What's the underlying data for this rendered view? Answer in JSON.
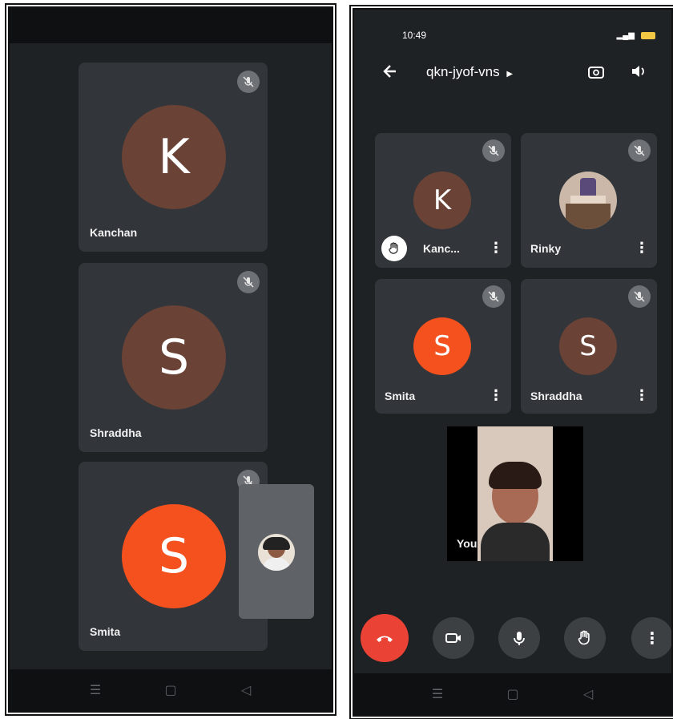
{
  "left_screen": {
    "participants": [
      {
        "initial": "K",
        "name": "Kanchan",
        "color": "#6a4236"
      },
      {
        "initial": "S",
        "name": "Shraddha",
        "color": "#6a4236"
      },
      {
        "initial": "S",
        "name": "Smita",
        "color": "#f4511e"
      }
    ]
  },
  "right_screen": {
    "status": {
      "time": "10:49"
    },
    "meeting_code": "qkn-jyof-vns",
    "participants": [
      {
        "initial": "K",
        "name": "Kanc...",
        "color": "#6a4236",
        "hand_raised": true
      },
      {
        "initial": "",
        "name": "Rinky",
        "color": "#8a7a7a"
      },
      {
        "initial": "S",
        "name": "Smita",
        "color": "#f4511e"
      },
      {
        "initial": "S",
        "name": "Shraddha",
        "color": "#6a4236"
      }
    ],
    "self_label": "You"
  },
  "icons": {
    "back": "arrow-left-icon",
    "switch_camera": "switch-camera-icon",
    "speaker": "speaker-icon",
    "mic_off": "mic-off-icon",
    "hand": "raise-hand-icon",
    "more": "more-vert-icon",
    "end_call": "end-call-icon",
    "camera": "camera-icon",
    "mic": "mic-icon"
  },
  "colors": {
    "end_call": "#ea4335",
    "control_bg": "#3c4043"
  }
}
